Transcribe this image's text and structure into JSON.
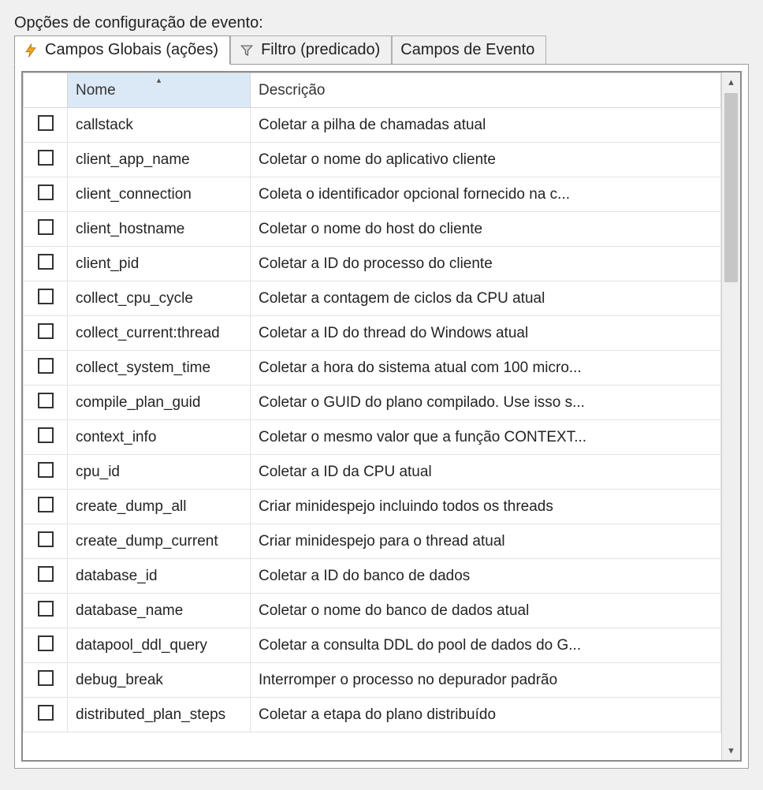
{
  "heading": "Opções de configuração de evento:",
  "tabs": [
    {
      "label": "Campos Globais (ações)",
      "icon": "lightning-icon",
      "active": true
    },
    {
      "label": "Filtro (predicado)",
      "icon": "funnel-icon",
      "active": false
    },
    {
      "label": "Campos de Evento",
      "icon": "",
      "active": false
    }
  ],
  "columns": {
    "checkbox": "",
    "name": "Nome",
    "description": "Descrição"
  },
  "sort": {
    "column": "name",
    "direction": "asc"
  },
  "rows": [
    {
      "checked": false,
      "name": "callstack",
      "description": "Coletar a pilha de chamadas atual"
    },
    {
      "checked": false,
      "name": "client_app_name",
      "description": "Coletar o nome do aplicativo cliente"
    },
    {
      "checked": false,
      "name": "client_connection",
      "description": "Coleta o identificador opcional fornecido na c..."
    },
    {
      "checked": false,
      "name": "client_hostname",
      "description": "Coletar o nome do host do cliente"
    },
    {
      "checked": false,
      "name": "client_pid",
      "description": "Coletar a ID do processo do cliente"
    },
    {
      "checked": false,
      "name": "collect_cpu_cycle",
      "description": "Coletar a contagem de ciclos da CPU atual"
    },
    {
      "checked": false,
      "name": "collect_current:thread",
      "description": "Coletar a ID do thread do Windows atual"
    },
    {
      "checked": false,
      "name": "collect_system_time",
      "description": "Coletar a hora do sistema atual com 100 micro..."
    },
    {
      "checked": false,
      "name": "compile_plan_guid",
      "description": "Coletar o GUID do plano compilado. Use isso s..."
    },
    {
      "checked": false,
      "name": "context_info",
      "description": "Coletar o mesmo valor que a função CONTEXT..."
    },
    {
      "checked": false,
      "name": "cpu_id",
      "description": "Coletar a ID da CPU atual"
    },
    {
      "checked": false,
      "name": "create_dump_all",
      "description": "Criar minidespejo incluindo todos os threads"
    },
    {
      "checked": false,
      "name": "create_dump_current",
      "description": "Criar minidespejo para o thread atual"
    },
    {
      "checked": false,
      "name": "database_id",
      "description": "Coletar a ID do banco de dados"
    },
    {
      "checked": false,
      "name": "database_name",
      "description": "Coletar o nome do banco de dados atual"
    },
    {
      "checked": false,
      "name": "datapool_ddl_query",
      "description": "Coletar a consulta DDL do pool de dados do G..."
    },
    {
      "checked": false,
      "name": "debug_break",
      "description": "Interromper o processo no depurador padrão"
    },
    {
      "checked": false,
      "name": "distributed_plan_steps",
      "description": "Coletar a etapa do plano distribuído"
    }
  ]
}
